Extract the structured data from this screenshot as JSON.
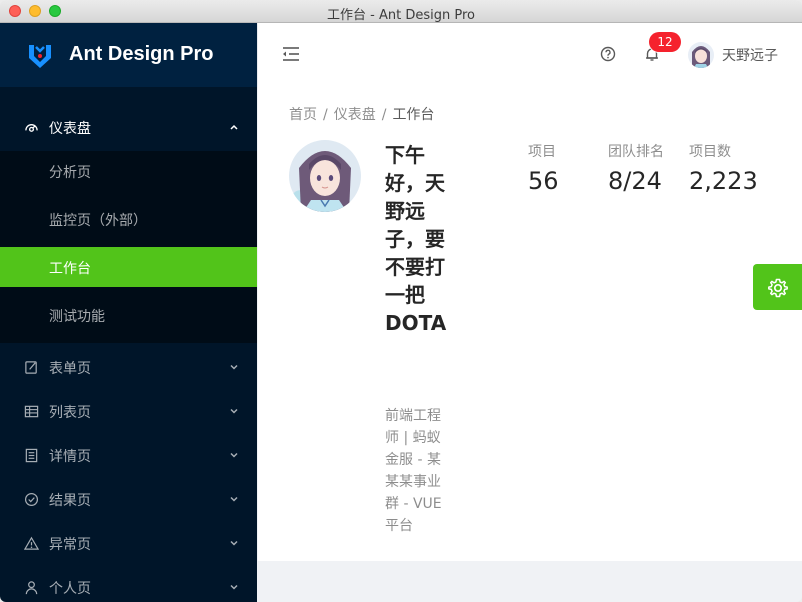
{
  "window": {
    "title": "工作台 - Ant Design Pro"
  },
  "logo": {
    "text": "Ant Design Pro"
  },
  "sidebar": {
    "items": [
      {
        "label": "仪表盘",
        "icon": "dashboard-icon",
        "open": true
      },
      {
        "label": "表单页",
        "icon": "form-icon"
      },
      {
        "label": "列表页",
        "icon": "table-icon"
      },
      {
        "label": "详情页",
        "icon": "profile-icon"
      },
      {
        "label": "结果页",
        "icon": "check-circle-icon"
      },
      {
        "label": "异常页",
        "icon": "warning-icon"
      },
      {
        "label": "个人页",
        "icon": "user-icon"
      }
    ],
    "submenu": [
      {
        "label": "分析页"
      },
      {
        "label": "监控页（外部）"
      },
      {
        "label": "工作台",
        "active": true
      },
      {
        "label": "测试功能"
      }
    ]
  },
  "header": {
    "notification_count": "12",
    "username": "天野远子"
  },
  "page": {
    "breadcrumb": [
      "首页",
      "仪表盘",
      "工作台"
    ],
    "greeting": "下午好，天野远子，要不要打一把 DOTA",
    "job": "前端工程师 | 蚂蚁金服 - 某某某事业群 - VUE平台",
    "stats": [
      {
        "title": "项目",
        "value": "56"
      },
      {
        "title": "团队排名",
        "value": "8/24"
      },
      {
        "title": "项目数",
        "value": "2,223"
      }
    ]
  },
  "colors": {
    "accent": "#52c41a",
    "sider": "#001529",
    "badge": "#f5222d"
  }
}
